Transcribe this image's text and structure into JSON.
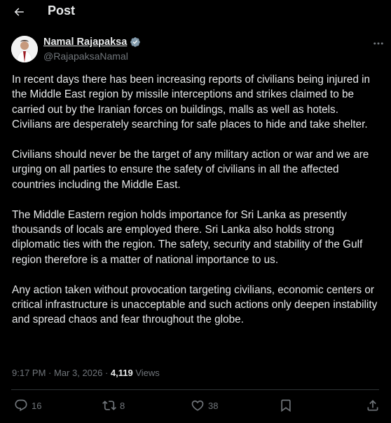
{
  "header": {
    "title": "Post"
  },
  "author": {
    "display_name": "Namal Rajapaksa",
    "handle": "@RajapaksaNamal"
  },
  "post": {
    "paragraphs": [
      "In recent days there has been increasing reports of civilians being injured in the Middle East region by missile interceptions and strikes claimed to be carried out by the Iranian forces on buildings, malls as well as hotels. Civilians are desperately searching for safe places to hide and take shelter.",
      "Civilians should never be the target of any military action or war and we are urging on all parties to ensure the safety of civilians in all the affected countries including the Middle East.",
      "The Middle Eastern region holds importance for Sri Lanka as presently thousands of locals are employed there. Sri Lanka also holds strong diplomatic ties with the region. The safety, security and stability of the Gulf region therefore is a matter of national importance to us.",
      "Any action taken without provocation targeting civilians, economic centers or critical infrastructure is unacceptable and such actions only deepen instability and spread chaos and fear throughout the globe."
    ],
    "time": "9:17 PM",
    "separator": " · ",
    "date": "Mar 3, 2026",
    "views_count": "4,119",
    "views_label": " Views"
  },
  "actions": {
    "replies": "16",
    "reposts": "8",
    "likes": "38"
  },
  "colors": {
    "background": "#000000",
    "text": "#e7e9ea",
    "muted": "#71767b",
    "verified": "#829aab",
    "divider": "#2f3336"
  },
  "icons": [
    "back-arrow-icon",
    "verified-badge-icon",
    "more-icon",
    "reply-icon",
    "repost-icon",
    "like-icon",
    "bookmark-icon",
    "share-icon"
  ]
}
